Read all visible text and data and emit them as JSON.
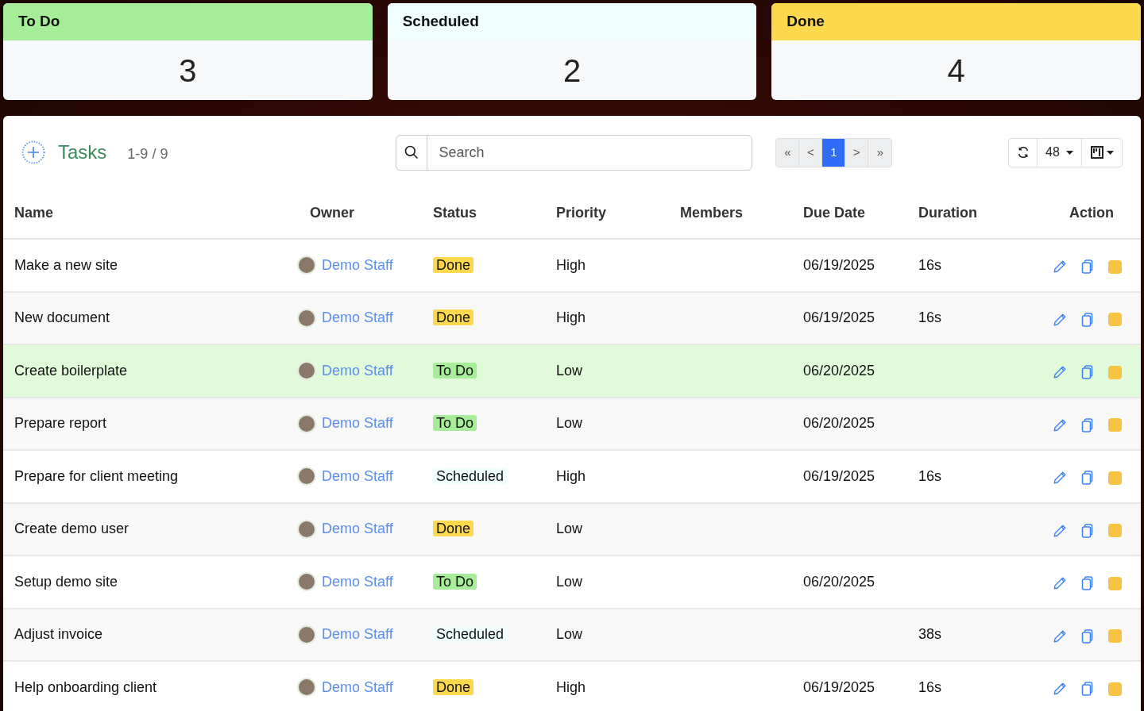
{
  "summary_cards": [
    {
      "label": "To Do",
      "count": "3",
      "color": "#a7ec98"
    },
    {
      "label": "Scheduled",
      "count": "2",
      "color": "#effefd"
    },
    {
      "label": "Done",
      "count": "4",
      "color": "#fbd84c"
    }
  ],
  "tasks_panel": {
    "title": "Tasks",
    "range": "1-9 / 9",
    "search": {
      "placeholder": "Search"
    },
    "pagination": [
      {
        "label": "«",
        "selected": false
      },
      {
        "label": "<",
        "selected": false
      },
      {
        "label": "1",
        "selected": true
      },
      {
        "label": ">",
        "selected": false
      },
      {
        "label": "»",
        "selected": false
      }
    ],
    "page_size": "48"
  },
  "table": {
    "columns": [
      "Name",
      "Owner",
      "Status",
      "Priority",
      "Members",
      "Due Date",
      "Duration",
      "Action"
    ],
    "rows": [
      {
        "name": "Make a new site",
        "owner": "Demo Staff",
        "status": {
          "label": "Done",
          "color": "#fbd84c"
        },
        "priority": "High",
        "due_date": "06/19/2025",
        "duration": "16s",
        "selected": false
      },
      {
        "name": "New document",
        "owner": "Demo Staff",
        "status": {
          "label": "Done",
          "color": "#fbd84c"
        },
        "priority": "High",
        "due_date": "06/19/2025",
        "duration": "16s",
        "selected": false
      },
      {
        "name": "Create boilerplate",
        "owner": "Demo Staff",
        "status": {
          "label": "To Do",
          "color": "#a7ec98"
        },
        "priority": "Low",
        "due_date": "06/20/2025",
        "duration": "",
        "selected": true
      },
      {
        "name": "Prepare report",
        "owner": "Demo Staff",
        "status": {
          "label": "To Do",
          "color": "#a7ec98"
        },
        "priority": "Low",
        "due_date": "06/20/2025",
        "duration": "",
        "selected": false
      },
      {
        "name": "Prepare for client meeting",
        "owner": "Demo Staff",
        "status": {
          "label": "Scheduled",
          "color": "#effefd"
        },
        "priority": "High",
        "due_date": "06/19/2025",
        "duration": "16s",
        "selected": false
      },
      {
        "name": "Create demo user",
        "owner": "Demo Staff",
        "status": {
          "label": "Done",
          "color": "#fbd84c"
        },
        "priority": "Low",
        "due_date": "",
        "duration": "",
        "selected": false
      },
      {
        "name": "Setup demo site",
        "owner": "Demo Staff",
        "status": {
          "label": "To Do",
          "color": "#a7ec98"
        },
        "priority": "Low",
        "due_date": "06/20/2025",
        "duration": "",
        "selected": false
      },
      {
        "name": "Adjust invoice",
        "owner": "Demo Staff",
        "status": {
          "label": "Scheduled",
          "color": "#effefd"
        },
        "priority": "Low",
        "due_date": "",
        "duration": "38s",
        "selected": false
      },
      {
        "name": "Help onboarding client",
        "owner": "Demo Staff",
        "status": {
          "label": "Done",
          "color": "#fbd84c"
        },
        "priority": "High",
        "due_date": "06/19/2025",
        "duration": "16s",
        "selected": false
      }
    ]
  }
}
